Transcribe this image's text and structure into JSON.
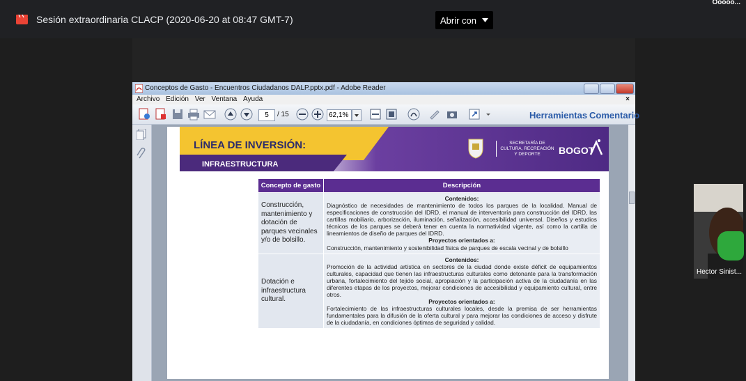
{
  "meeting": {
    "title": "Sesión extraordinaria CLACP (2020-06-20 at 08:47 GMT-7)",
    "open_with": "Abrir con",
    "corner_text": "Ooooo..."
  },
  "reader": {
    "window_title": "Conceptos de Gasto - Encuentros Ciudadanos DALP.pptx.pdf - Adobe Reader",
    "menu": [
      "Archivo",
      "Edición",
      "Ver",
      "Ventana",
      "Ayuda"
    ],
    "close_x": "×",
    "page_current": "5",
    "page_total": "/ 15",
    "zoom": "62,1%",
    "tools": "Herramientas",
    "comment": "Comentario"
  },
  "slide": {
    "heading": "LÍNEA DE INVERSIÓN:",
    "subheading": "INFRAESTRUCTURA",
    "logo_org": "SECRETARÍA DE\nCULTURA, RECREACIÓN\nY DEPORTE",
    "logo_city": "BOGOT",
    "table": {
      "headers": [
        "Concepto de gasto",
        "Descripción"
      ],
      "rows": [
        {
          "concept": "Construcción, mantenimiento y dotación de parques vecinales y/o de bolsillo.",
          "contents_label": "Contenidos:",
          "contents": "Diagnóstico de necesidades de mantenimiento de todos los parques de la localidad. Manual de especificaciones de construcción del IDRD, el manual de interventoría para construcción del IDRD, las cartillas mobiliario, arborización, iluminación, señalización, accesibilidad universal. Diseños y estudios técnicos de los parques se deberá tener en cuenta la normatividad vigente, así como la cartilla de lineamientos de diseño de parques del IDRD.",
          "projects_label": "Proyectos orientados a:",
          "projects": "Construcción, mantenimiento y sostenibilidad física de parques de escala vecinal y de bolsillo"
        },
        {
          "concept": "Dotación e infraestructura cultural.",
          "contents_label": "Contenidos:",
          "contents": "Promoción de la actividad artística en sectores de la ciudad donde existe déficit de equipamientos culturales, capacidad que tienen las infraestructuras culturales como detonante para la transformación urbana, fortalecimiento del tejido social, apropiación y la participación activa de la ciudadanía en las diferentes etapas de los proyectos, mejorar condiciones de accesibilidad y equipamiento cultural, entre otros.",
          "projects_label": "Proyectos orientados a:",
          "projects": "Fortalecimiento de las infraestructuras culturales locales, desde la premisa de ser herramientas fundamentales para la difusión de la oferta cultural y para mejorar las condiciones de acceso y disfrute de la ciudadanía, en condiciones óptimas de seguridad y calidad."
        }
      ]
    }
  },
  "participant": {
    "name": "Hector Sinist..."
  },
  "colors": {
    "meet_bg": "#202124",
    "slide_purple": "#5b2d91",
    "slide_yellow": "#f4c430",
    "reader_link": "#2a5ba8"
  }
}
